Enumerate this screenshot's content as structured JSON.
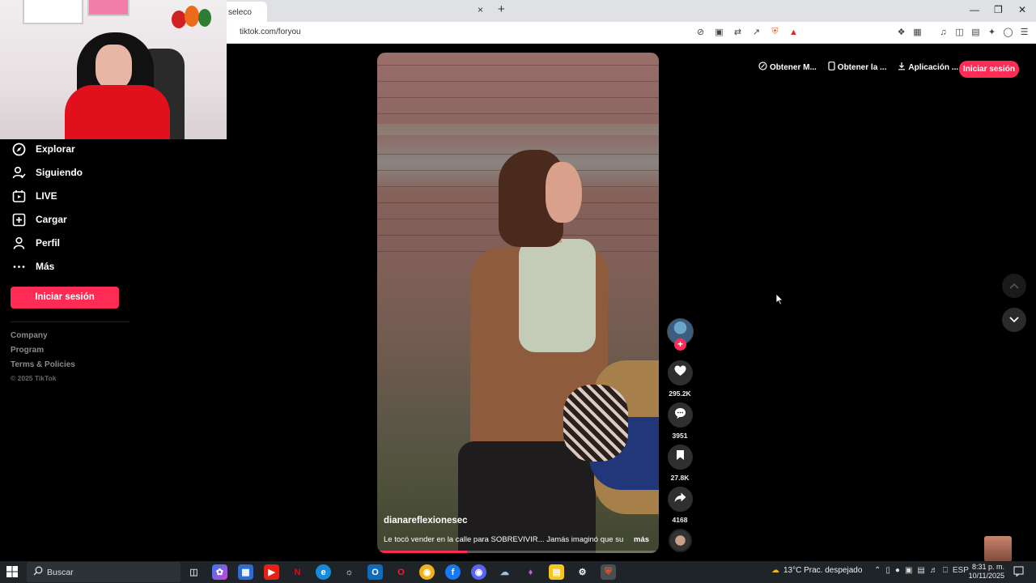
{
  "browser": {
    "tab_title": "seleco",
    "url": "tiktok.com/foryou",
    "new_tab": "+",
    "close_tab": "×"
  },
  "sidebar": {
    "items": [
      {
        "label": "Explorar",
        "icon": "compass-icon"
      },
      {
        "label": "Siguiendo",
        "icon": "following-icon"
      },
      {
        "label": "LIVE",
        "icon": "live-icon"
      },
      {
        "label": "Cargar",
        "icon": "upload-icon"
      },
      {
        "label": "Perfil",
        "icon": "profile-icon"
      },
      {
        "label": "Más",
        "icon": "more-icon"
      }
    ],
    "login_label": "Iniciar sesión",
    "footer_links": [
      "Company",
      "Program",
      "Terms & Policies"
    ],
    "copyright": "© 2025 TikTok"
  },
  "header": {
    "links": [
      {
        "label": "Obtener M...",
        "icon": "coin-icon"
      },
      {
        "label": "Obtener la ...",
        "icon": "phone-icon"
      },
      {
        "label": "Aplicación ...",
        "icon": "download-icon"
      }
    ],
    "login_label": "Iniciar sesión"
  },
  "video": {
    "username": "dianareflexionesec",
    "caption": "Le tocó vender en la calle para SOBREVIVIR... Jamás imaginó que su",
    "more_label": "más",
    "progress": 0.32
  },
  "actions": {
    "likes": "295.2K",
    "comments": "3951",
    "saves": "27.8K",
    "shares": "4168"
  },
  "taskbar": {
    "search_placeholder": "Buscar",
    "weather": "13°C  Prac. despejado",
    "language": "ESP",
    "time": "8:31 p. m.",
    "date": "10/11/2025"
  },
  "colors": {
    "accent": "#fe2c55",
    "background": "#000000"
  }
}
